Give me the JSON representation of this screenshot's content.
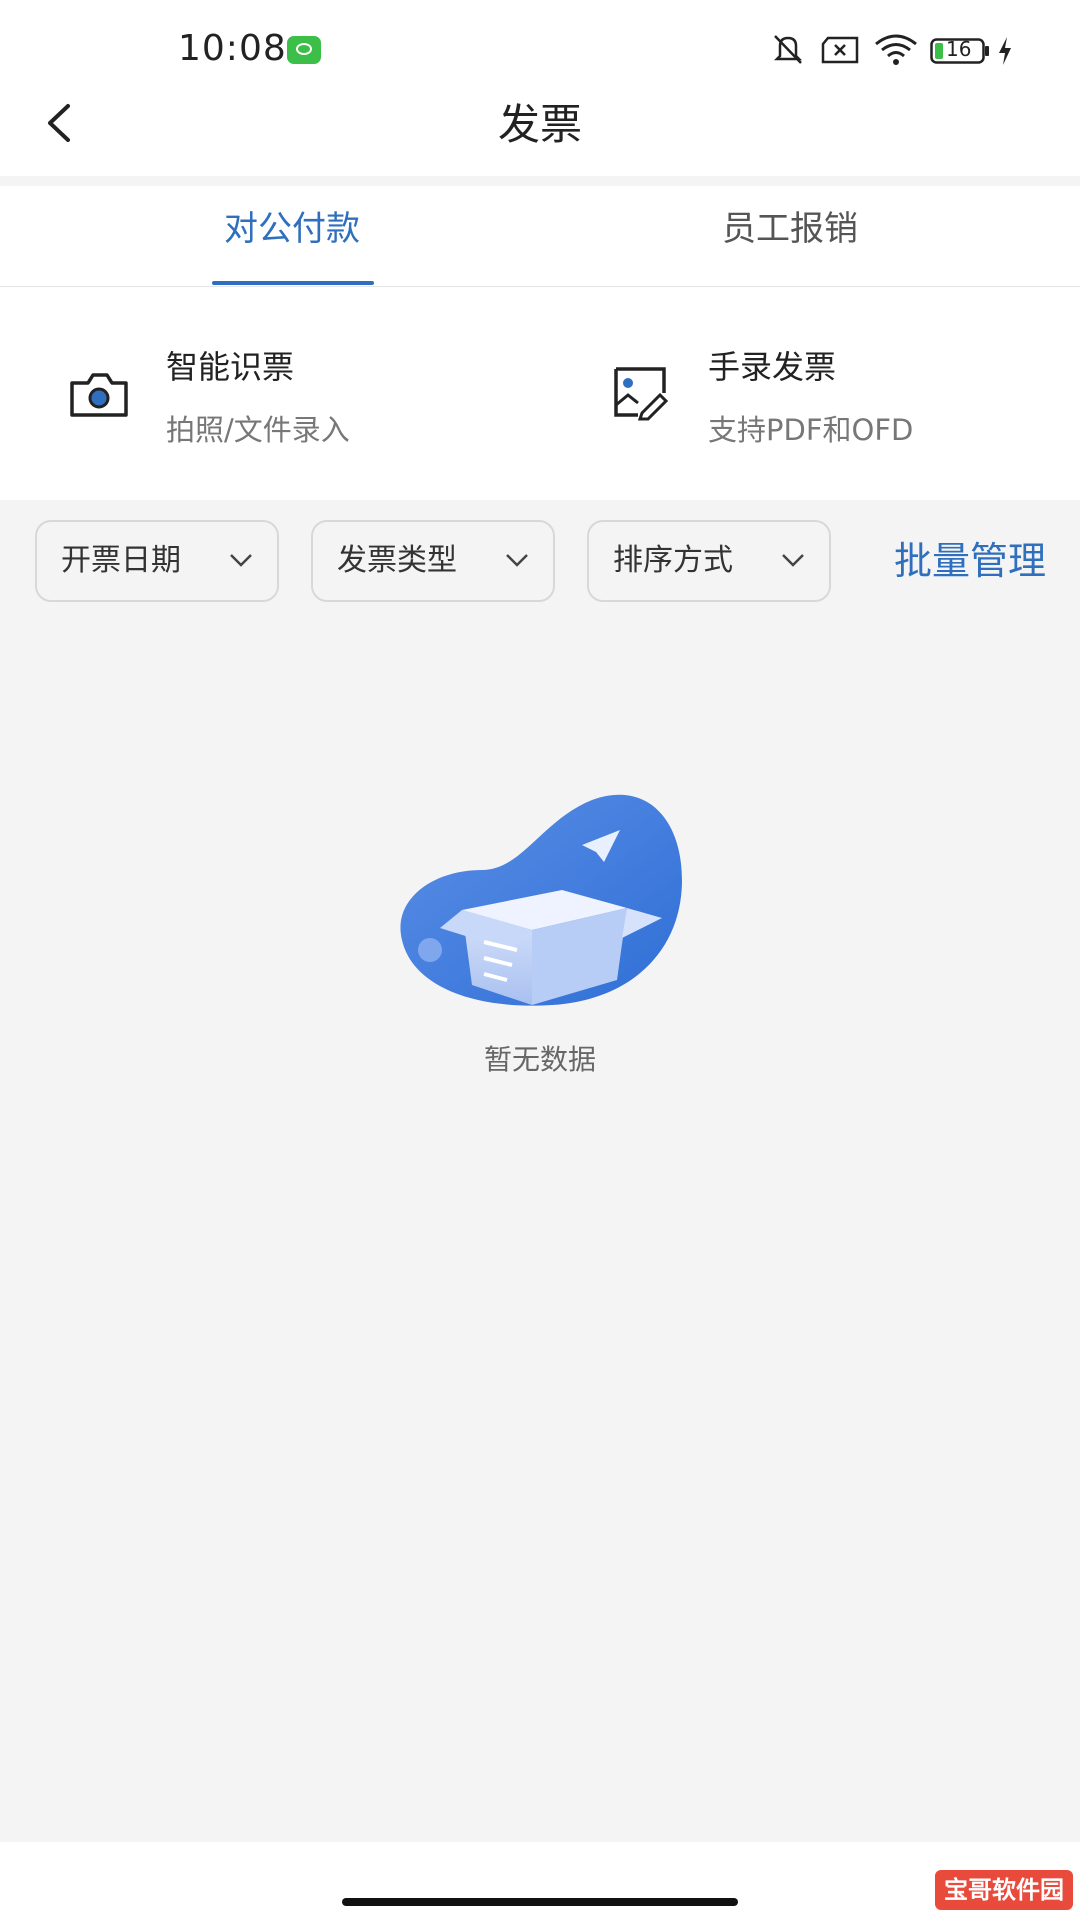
{
  "status_bar": {
    "time": "10:08",
    "battery": "16",
    "icons": [
      "wechat-icon",
      "mute-icon",
      "sim-off-icon",
      "wifi-icon",
      "battery-icon",
      "charging-icon"
    ]
  },
  "nav": {
    "title": "发票",
    "back_icon": "chevron-left-icon"
  },
  "tabs": [
    {
      "label": "对公付款",
      "active": true
    },
    {
      "label": "员工报销",
      "active": false
    }
  ],
  "entries": [
    {
      "title": "智能识票",
      "subtitle": "拍照/文件录入",
      "icon": "camera-icon"
    },
    {
      "title": "手录发票",
      "subtitle": "支持PDF和OFD",
      "icon": "edit-image-icon"
    }
  ],
  "filters": [
    {
      "label": "开票日期"
    },
    {
      "label": "发票类型"
    },
    {
      "label": "排序方式"
    }
  ],
  "batch_manage": "批量管理",
  "empty_state": {
    "text": "暂无数据",
    "illustration": "empty-box-illustration"
  },
  "watermark": "宝哥软件园",
  "colors": {
    "accent": "#2f6fbe",
    "background": "#f4f4f5",
    "surface": "#ffffff",
    "wechat_green": "#3bbf48",
    "watermark_red": "#e84a3c"
  }
}
